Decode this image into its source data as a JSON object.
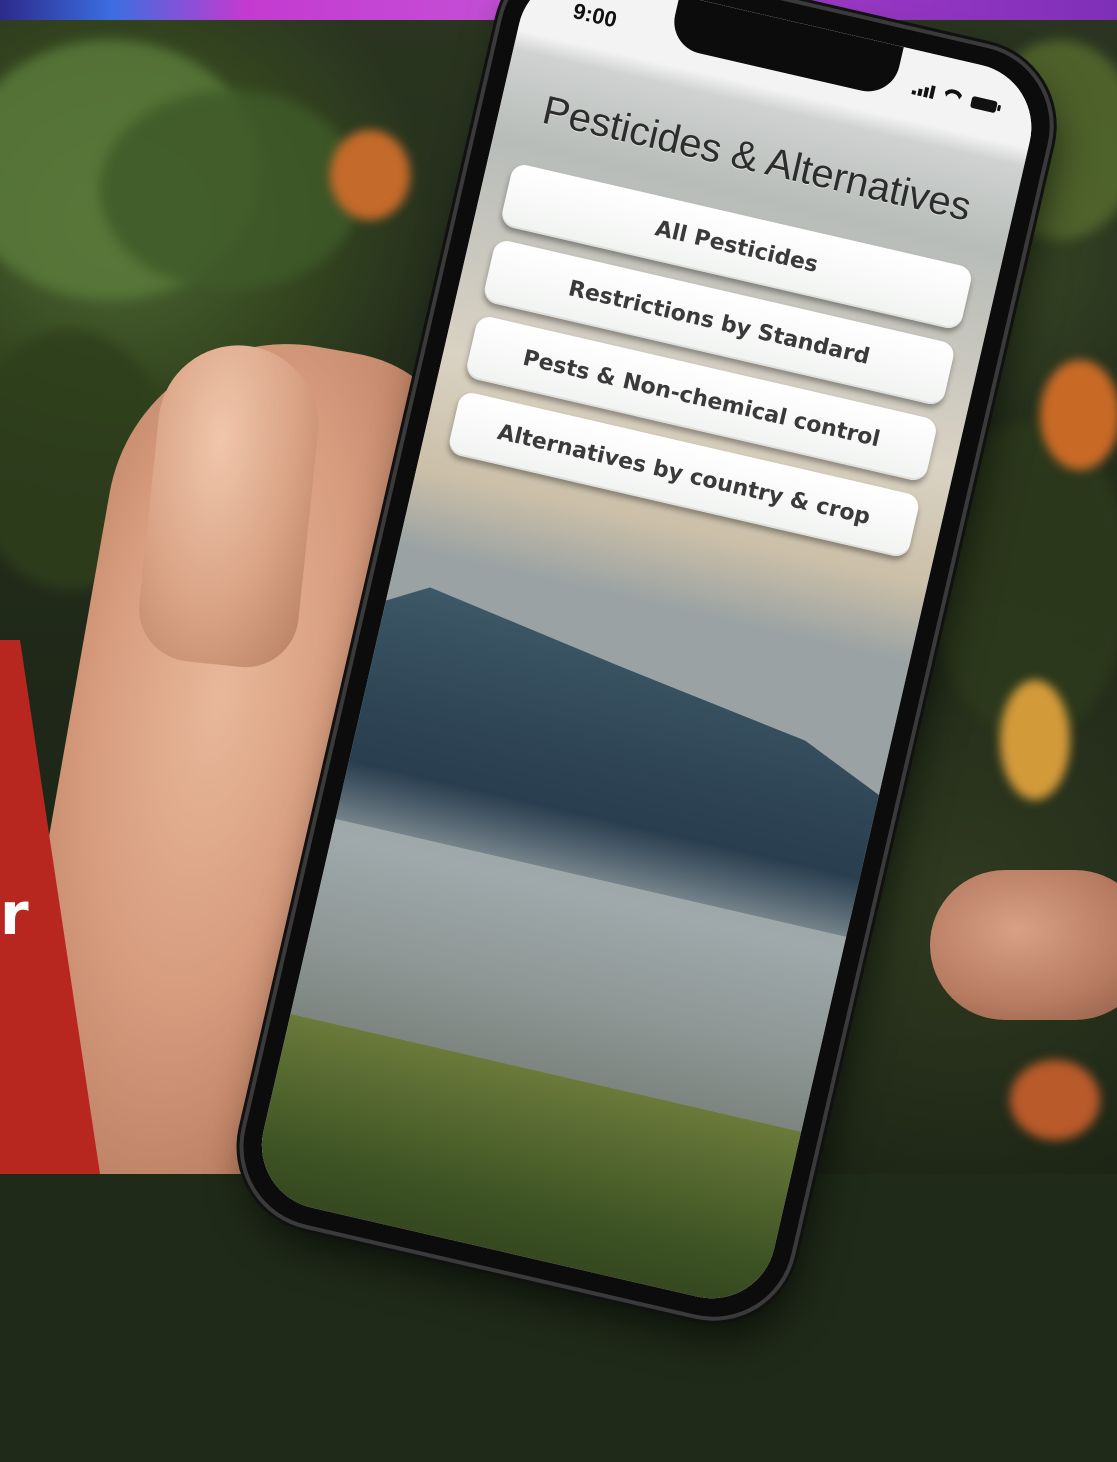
{
  "banner": {
    "colors": [
      "#2d2a8a",
      "#3b6ee0",
      "#c43ad0",
      "#a13ac9",
      "#7e2fb8"
    ]
  },
  "side_panel": {
    "color": "#b8271f",
    "visible_letter": "r"
  },
  "phone": {
    "status_bar": {
      "time": "9:00",
      "icons": [
        "signal-icon",
        "wifi-icon",
        "battery-icon"
      ]
    },
    "app": {
      "title": "Pesticides & Alternatives",
      "menu": [
        {
          "label": "All Pesticides"
        },
        {
          "label": "Restrictions by Standard"
        },
        {
          "label": "Pests & Non-chemical control"
        },
        {
          "label": "Alternatives by country & crop"
        }
      ]
    }
  }
}
